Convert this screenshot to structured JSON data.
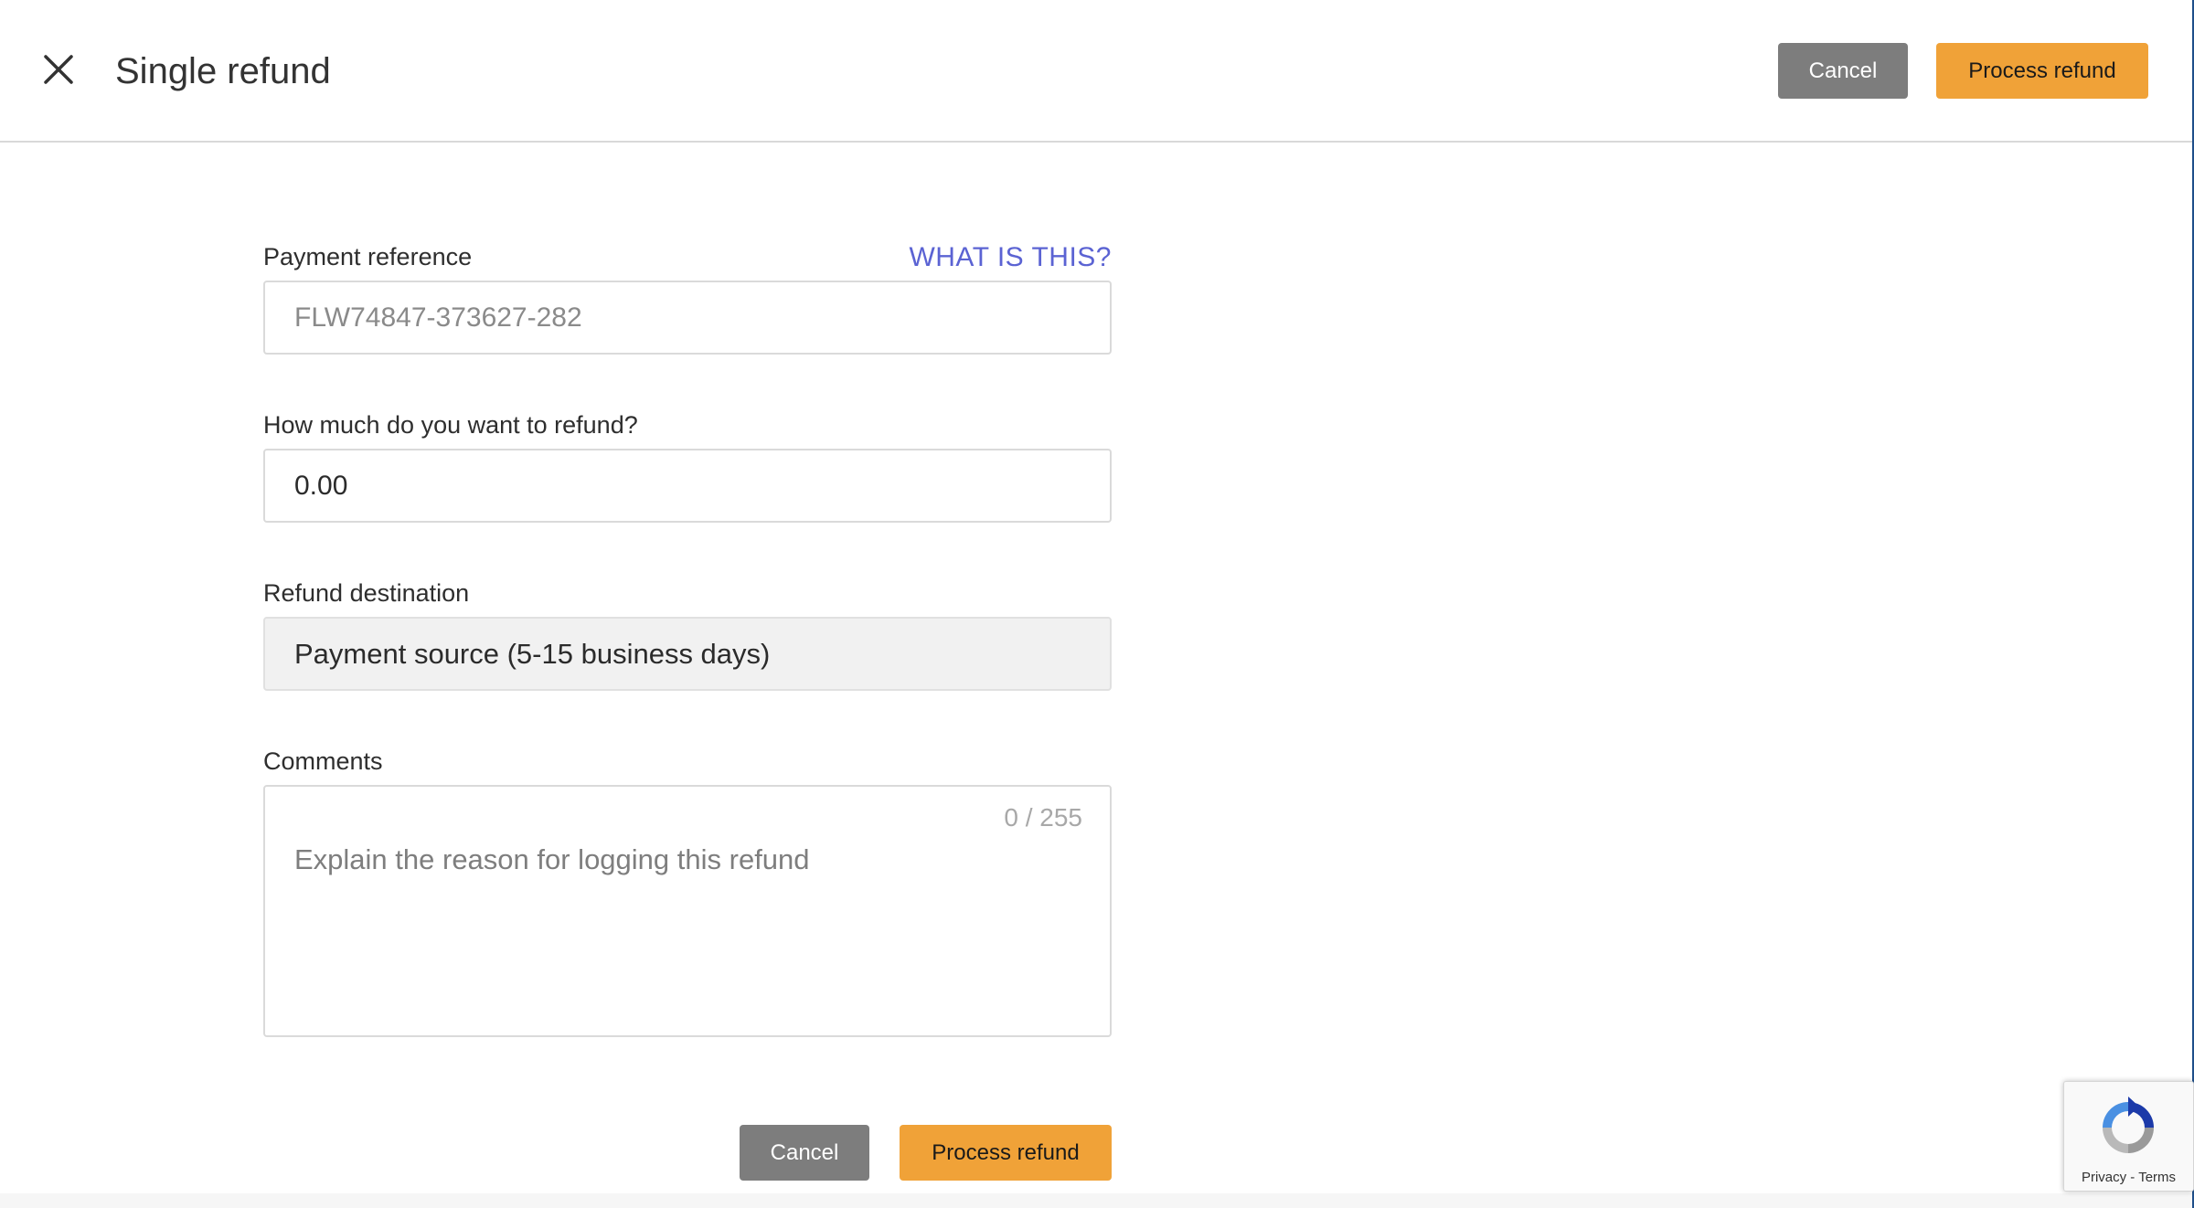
{
  "header": {
    "title": "Single refund",
    "cancel_label": "Cancel",
    "process_label": "Process refund"
  },
  "form": {
    "payment_reference": {
      "label": "Payment reference",
      "help_link": "WHAT IS THIS?",
      "placeholder": "FLW74847-373627-282",
      "value": ""
    },
    "amount": {
      "label": "How much do you want to refund?",
      "value": "0.00"
    },
    "destination": {
      "label": "Refund destination",
      "selected": "Payment source (5-15 business days)"
    },
    "comments": {
      "label": "Comments",
      "placeholder": "Explain the reason for logging this refund",
      "counter": "0 / 255"
    }
  },
  "footer": {
    "cancel_label": "Cancel",
    "process_label": "Process refund"
  },
  "recaptcha": {
    "privacy": "Privacy",
    "separator": " - ",
    "terms": "Terms"
  },
  "colors": {
    "primary": "#f0a238",
    "cancel": "#7d7d7d",
    "link": "#5b63d3"
  }
}
